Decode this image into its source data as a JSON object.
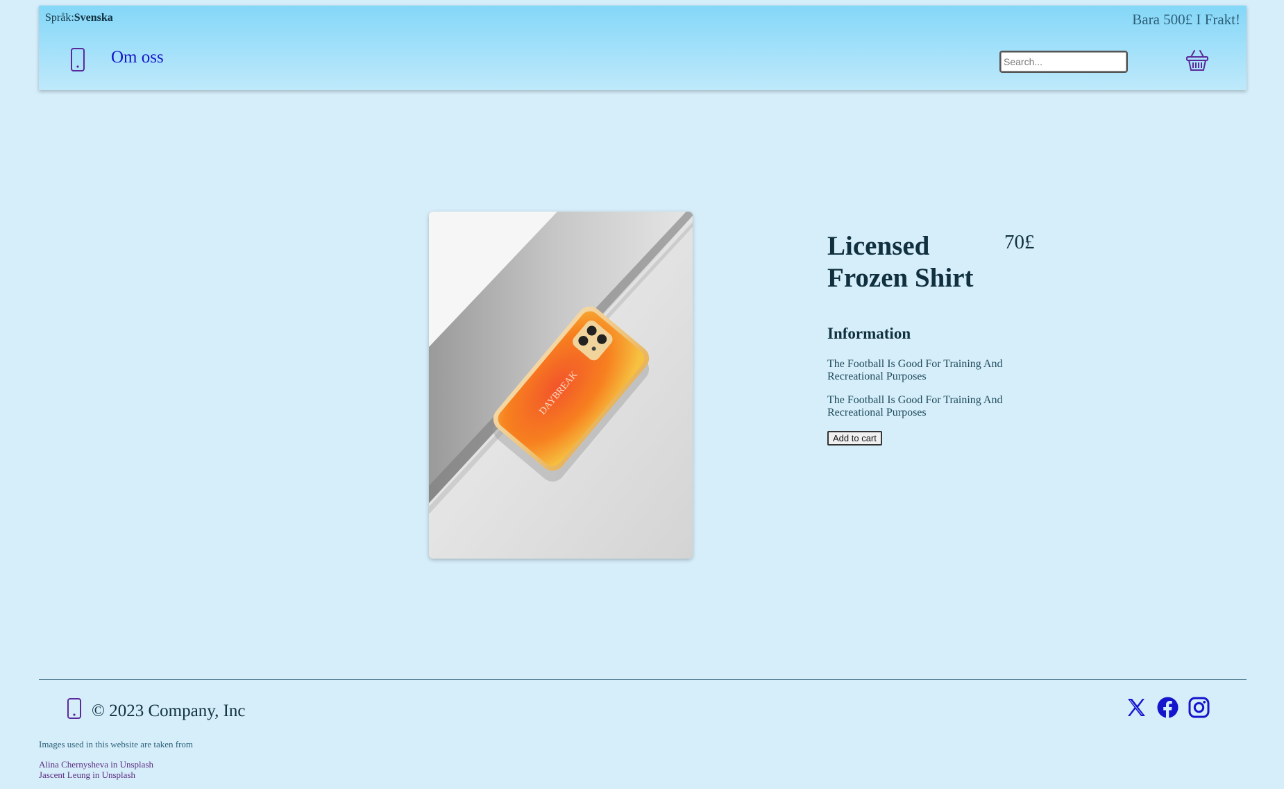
{
  "header": {
    "language_label": "Språk:",
    "language_value": "Svenska",
    "promo": "Bara 500£ I Frakt!",
    "about_link": "Om oss",
    "search_placeholder": "Search..."
  },
  "product": {
    "title": "Licensed Frozen Shirt",
    "price": "70£",
    "info_heading": "Information",
    "descriptions": [
      "The Football Is Good For Training And Recreational Purposes",
      "The Football Is Good For Training And Recreational Purposes"
    ],
    "add_to_cart_label": "Add to cart"
  },
  "footer": {
    "copyright": "© 2023 Company, Inc",
    "credits_note": "Images used in this website are taken from",
    "credits": [
      "Alina Chernysheva in Unsplash",
      "Jascent Leung in Unsplash"
    ],
    "socials": [
      "x-icon",
      "facebook-icon",
      "instagram-icon"
    ]
  },
  "colors": {
    "background": "#d6eefa",
    "header_gradient_top": "#84d7f8",
    "header_gradient_bottom": "#bfe9fb",
    "link": "#1515cc",
    "icon_purple": "#5a2a9a"
  }
}
